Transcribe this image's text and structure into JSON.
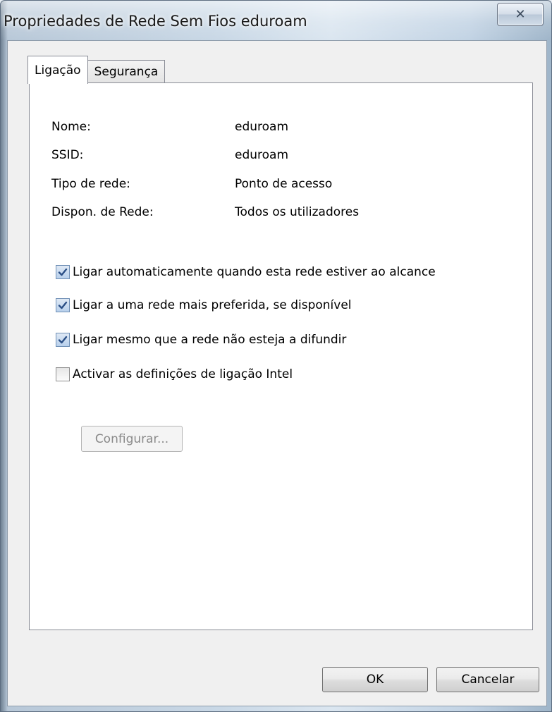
{
  "window": {
    "title": "Propriedades de Rede Sem Fios eduroam",
    "close_icon": "close-x-icon"
  },
  "tabs": [
    {
      "label": "Ligação",
      "active": true
    },
    {
      "label": "Segurança",
      "active": false
    }
  ],
  "properties": [
    {
      "label": "Nome:",
      "value": "eduroam"
    },
    {
      "label": "SSID:",
      "value": "eduroam"
    },
    {
      "label": "Tipo de rede:",
      "value": "Ponto de acesso"
    },
    {
      "label": "Dispon. de Rede:",
      "value": "Todos os utilizadores"
    }
  ],
  "options": [
    {
      "label": "Ligar automaticamente quando esta rede estiver ao alcance",
      "checked": true
    },
    {
      "label": "Ligar a uma rede mais preferida, se disponível",
      "checked": true
    },
    {
      "label": "Ligar mesmo que a rede não esteja a difundir",
      "checked": true
    },
    {
      "label": "Activar as definições de ligação Intel",
      "checked": false
    }
  ],
  "configure_button": {
    "label": "Configurar...",
    "enabled": false
  },
  "footer": {
    "ok_label": "OK",
    "cancel_label": "Cancelar"
  }
}
